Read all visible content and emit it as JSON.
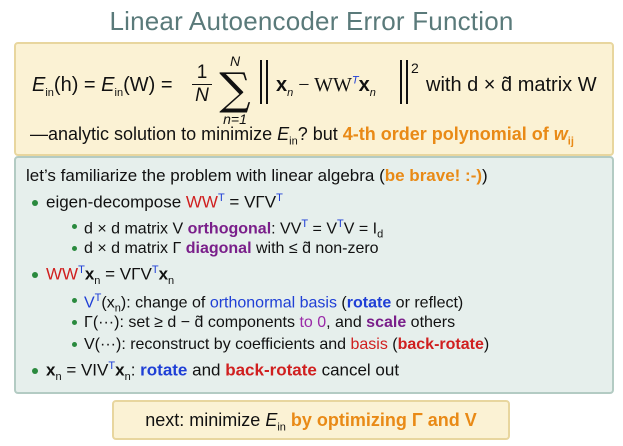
{
  "title": "Linear Autoencoder Error Function",
  "equation": {
    "lhs_a": "E",
    "lhs_a_sub": "in",
    "lhs_a_arg": "(h) = ",
    "lhs_b": "E",
    "lhs_b_sub": "in",
    "lhs_b_arg": "(W) =",
    "frac_num": "1",
    "frac_den": "N",
    "sum_upper": "N",
    "sum_lower": "n=1",
    "norm_body": "x",
    "norm_body_sub": "n",
    "norm_minus": " − WW",
    "norm_T": "T",
    "norm_x2": "x",
    "norm_x2_sub": "n",
    "power": "2",
    "tail": "with d × d̃ matrix W"
  },
  "line2": {
    "text1": "—analytic solution to minimize ",
    "e": "E",
    "e_sub": "in",
    "text2": "? but ",
    "highlight": "4-th order polynomial of ",
    "w": "w",
    "w_sub": "ij"
  },
  "intro": {
    "text": "let’s familiarize the problem with linear algebra (",
    "highlight": "be brave! :-)",
    "close": ")"
  },
  "bullets": {
    "b1": {
      "label": "eigen-decompose ",
      "math": "WW",
      "sup": "T",
      "eq": " = VΓV",
      "eq_sup": "T"
    },
    "b1_sub1": {
      "pre": "d × d matrix V ",
      "kw": "orthogonal",
      "post": ": VV",
      "s1": "T",
      "mid": " = V",
      "s2": "T",
      "end": "V = I",
      "sub": "d"
    },
    "b1_sub2": {
      "pre": "d × d matrix Γ ",
      "kw": "diagonal",
      "post": " with ≤ d̃ non-zero"
    },
    "b2": {
      "math": "WW",
      "sup": "T",
      "x": "x",
      "xsub": "n",
      "eq": " = VΓV",
      "eq_sup": "T",
      "x2": "x",
      "x2sub": "n"
    },
    "b2_sub1": {
      "pre": "V",
      "sup": "T",
      "arg": "(x",
      "argsub": "n",
      "argend": "): change of ",
      "kw1": "orthonormal basis",
      "mid": " (",
      "kw2": "rotate",
      "end": " or reflect)"
    },
    "b2_sub2": {
      "pre": "Γ(···): set ≥ d − d̃ components ",
      "kw1": "to 0",
      "mid": ", and ",
      "kw2": "scale",
      "end": " others"
    },
    "b2_sub3": {
      "pre": "V(···): reconstruct by coefficients and ",
      "kw1": "basis",
      "mid": " (",
      "kw2": "back-rotate",
      "end": ")"
    },
    "b3": {
      "x": "x",
      "xsub": "n",
      "eq": " = VIV",
      "sup": "T",
      "x2": "x",
      "x2sub": "n",
      "colon": ": ",
      "kw1": "rotate",
      "mid": " and ",
      "kw2": "back-rotate",
      "end": " cancel out"
    }
  },
  "next": {
    "pre": "next: minimize ",
    "e": "E",
    "e_sub": "in",
    "post": " by optimizing Γ and V"
  }
}
